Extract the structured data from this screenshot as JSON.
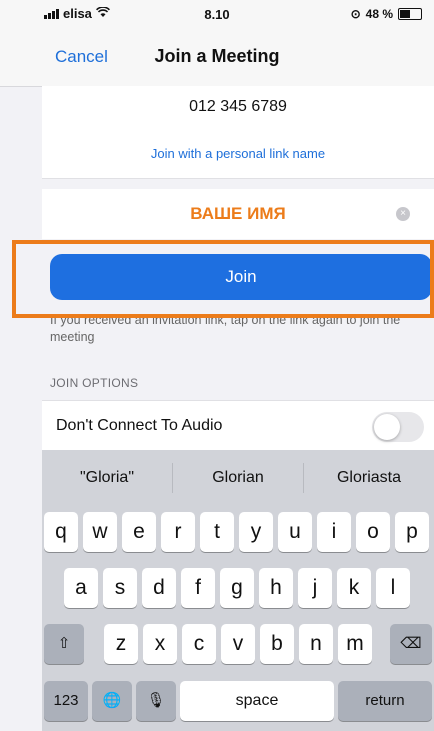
{
  "status": {
    "carrier": "elisa",
    "time": "8.10",
    "battery": "48 %"
  },
  "nav": {
    "cancel": "Cancel",
    "title": "Join a Meeting"
  },
  "meeting_id": "012 345 6789",
  "personal_link": "Join with a personal link name",
  "name_value": "ВАШЕ ИМЯ",
  "clear_icon": "×",
  "join_label": "Join",
  "hint": "If you received an invitation link, tap on the link again to join the meeting",
  "section_title": "JOIN OPTIONS",
  "audio_option": {
    "label": "Don't Connect To Audio",
    "on": false
  },
  "keyboard": {
    "suggestions": [
      "\"Gloria\"",
      "Glorian",
      "Gloriasta"
    ],
    "row1": [
      "q",
      "w",
      "e",
      "r",
      "t",
      "y",
      "u",
      "i",
      "o",
      "p"
    ],
    "row2": [
      "a",
      "s",
      "d",
      "f",
      "g",
      "h",
      "j",
      "k",
      "l"
    ],
    "row3": [
      "z",
      "x",
      "c",
      "v",
      "b",
      "n",
      "m"
    ],
    "shift_icon": "⇧",
    "backspace_icon": "⌫",
    "numbers": "123",
    "globe_icon": "🌐",
    "mic_icon": "🎙",
    "space": "space",
    "return": "return"
  },
  "colors": {
    "accent": "#1e6fe0",
    "highlight": "#ec7c1a"
  }
}
